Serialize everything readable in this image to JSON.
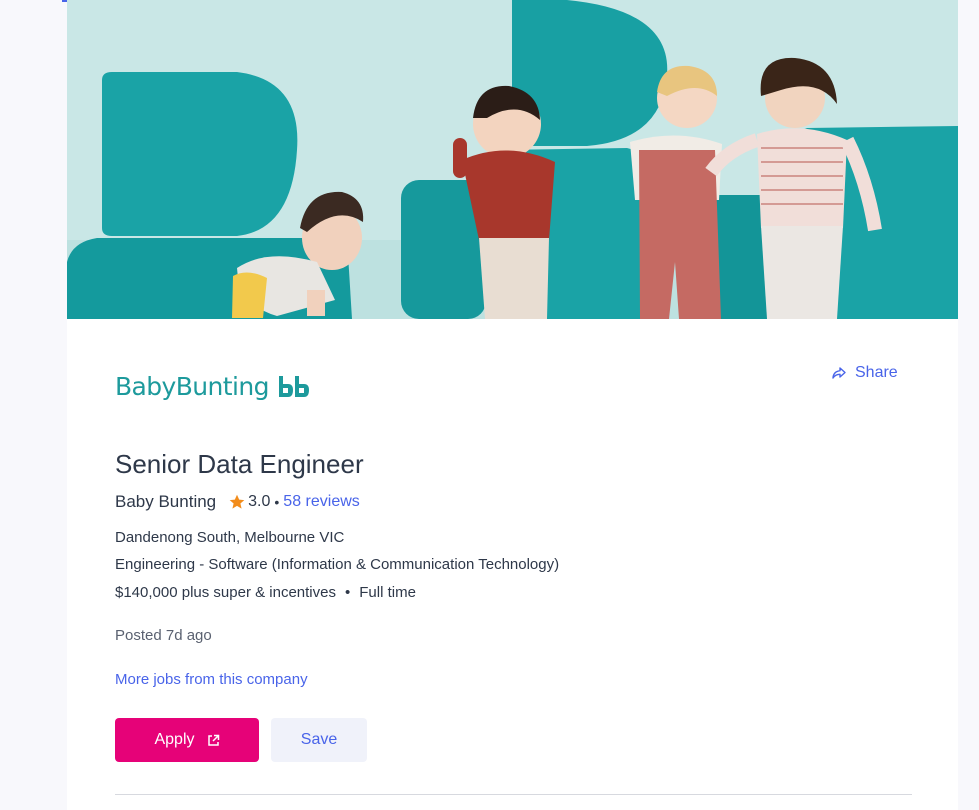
{
  "job": {
    "title": "Senior Data Engineer",
    "company": "Baby Bunting",
    "rating": "3.0",
    "rating_separator": "•",
    "reviews": "58 reviews",
    "location": "Dandenong South, Melbourne VIC",
    "category": "Engineering - Software (Information & Communication Technology)",
    "salary": "$140,000 plus super & incentives",
    "salary_separator": "•",
    "work_type": "Full time",
    "posted": "Posted 7d ago"
  },
  "brand": {
    "logo_text": "BabyBunting",
    "logo_color": "#1d9a9c"
  },
  "actions": {
    "share_label": "Share",
    "more_jobs_label": "More jobs from this company",
    "apply_label": "Apply",
    "save_label": "Save"
  },
  "icons": {
    "share": "share-arrow-icon",
    "star": "star-icon",
    "external": "external-link-icon"
  },
  "colors": {
    "accent": "#4964e9",
    "apply": "#e60278",
    "star": "#f28c1b",
    "save_bg": "#f0f2fa"
  }
}
